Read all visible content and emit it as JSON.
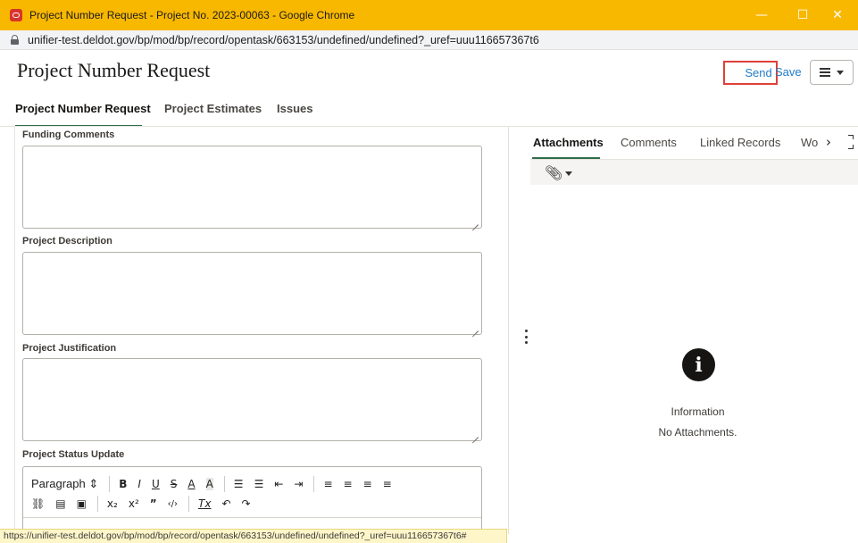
{
  "window": {
    "title": "Project Number Request - Project No. 2023-00063 - Google Chrome",
    "minimize_glyph": "—",
    "maximize_glyph": "☐",
    "close_glyph": "✕",
    "url": "unifier-test.deldot.gov/bp/mod/bp/record/opentask/663153/undefined/undefined?_uref=uuu116657367t6"
  },
  "header": {
    "title": "Project Number Request",
    "send_label": "Send",
    "save_label": "Save"
  },
  "tabs": [
    {
      "label": "Project Number Request",
      "active": true
    },
    {
      "label": "Project Estimates",
      "active": false
    },
    {
      "label": "Issues",
      "active": false
    }
  ],
  "form": {
    "funding_comments_label": "Funding Comments",
    "funding_comments_value": "",
    "project_description_label": "Project Description",
    "project_description_value": "",
    "project_justification_label": "Project Justification",
    "project_justification_value": "",
    "project_status_update_label": "Project Status Update",
    "editor": {
      "paragraph_label": "Paragraph",
      "row1": [
        "B",
        "I",
        "U",
        "S",
        "A",
        "A"
      ],
      "row2": [
        "x₂",
        "x²",
        "”",
        "‹/›",
        "Tx"
      ]
    }
  },
  "status_url": "https://unifier-test.deldot.gov/bp/mod/bp/record/opentask/663153/undefined/undefined?_uref=uuu116657367t6#",
  "right_panel": {
    "tabs": [
      {
        "label": "Attachments",
        "active": true
      },
      {
        "label": "Comments",
        "active": false
      },
      {
        "label": "Linked Records",
        "active": false
      },
      {
        "label": "Wo",
        "active": false
      }
    ],
    "info_title": "Information",
    "info_message": "No Attachments."
  },
  "colors": {
    "titlebar": "#f9b800",
    "accent_tab": "#2f6e4a",
    "link": "#227cc8",
    "highlight_box": "#e0403a"
  }
}
